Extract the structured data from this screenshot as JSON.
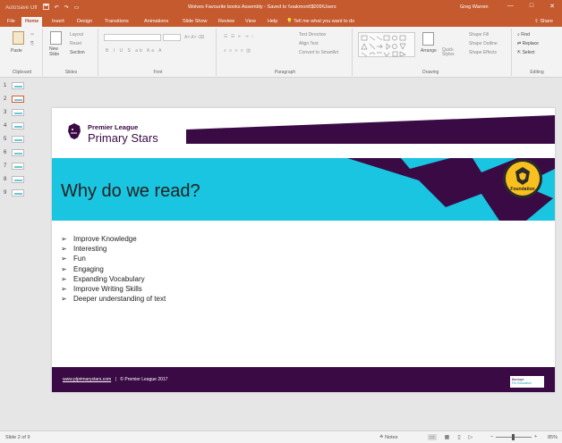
{
  "titlebar": {
    "autosave": "AutoSave",
    "autosave_state": "Off",
    "document_title": "Wolves Favourite books Assembly  -  Saved to \\\\oakmont\\$009\\Users",
    "user": "Greg Warren",
    "minimize": "—",
    "maximize": "□",
    "close": "✕"
  },
  "tabs": [
    "File",
    "Home",
    "Insert",
    "Design",
    "Transitions",
    "Animations",
    "Slide Show",
    "Review",
    "View",
    "Help"
  ],
  "active_tab": "Home",
  "tell_me": "Tell me what you want to do",
  "share": "Share",
  "ribbon": {
    "clipboard": {
      "label": "Clipboard",
      "paste": "Paste"
    },
    "slides": {
      "label": "Slides",
      "new_slide": "New Slide",
      "layout": "Layout",
      "reset": "Reset",
      "section": "Section"
    },
    "font": {
      "label": "Font"
    },
    "paragraph": {
      "label": "Paragraph",
      "text_direction": "Text Direction",
      "align_text": "Align Text",
      "convert": "Convert to SmartArt"
    },
    "drawing": {
      "label": "Drawing",
      "arrange": "Arrange",
      "quick_styles": "Quick Styles",
      "shape_fill": "Shape Fill",
      "shape_outline": "Shape Outline",
      "shape_effects": "Shape Effects"
    },
    "editing": {
      "label": "Editing",
      "find": "Find",
      "replace": "Replace",
      "select": "Select"
    }
  },
  "thumbnails": [
    "1",
    "2",
    "3",
    "4",
    "5",
    "6",
    "7",
    "8",
    "9"
  ],
  "selected_slide": 2,
  "slide": {
    "org_line1": "Premier League",
    "org_line2": "Primary Stars",
    "heading": "Why do we read?",
    "badge_text": "Foundation",
    "bullets": [
      "Improve Knowledge",
      "Interesting",
      "Fun",
      "Engaging",
      "Expanding Vocabulary",
      "Improve Writing Skills",
      "Deeper understanding of text"
    ],
    "footer_url": "www.plprimarystars.com",
    "footer_sep": "|",
    "footer_copyright": "© Premier League 2017",
    "sponsor_line1": "Barclays",
    "sponsor_line2": "For Education",
    "colors": {
      "purple": "#3a0a45",
      "cyan": "#19c5e0",
      "gold": "#f8c01f"
    }
  },
  "status": {
    "slide_counter": "Slide 2 of 9",
    "notes": "Notes",
    "zoom": "85%"
  },
  "icons": [
    "save-icon",
    "undo-icon",
    "redo-icon",
    "lightbulb-icon",
    "share-icon",
    "arrow-bullet-icon"
  ]
}
